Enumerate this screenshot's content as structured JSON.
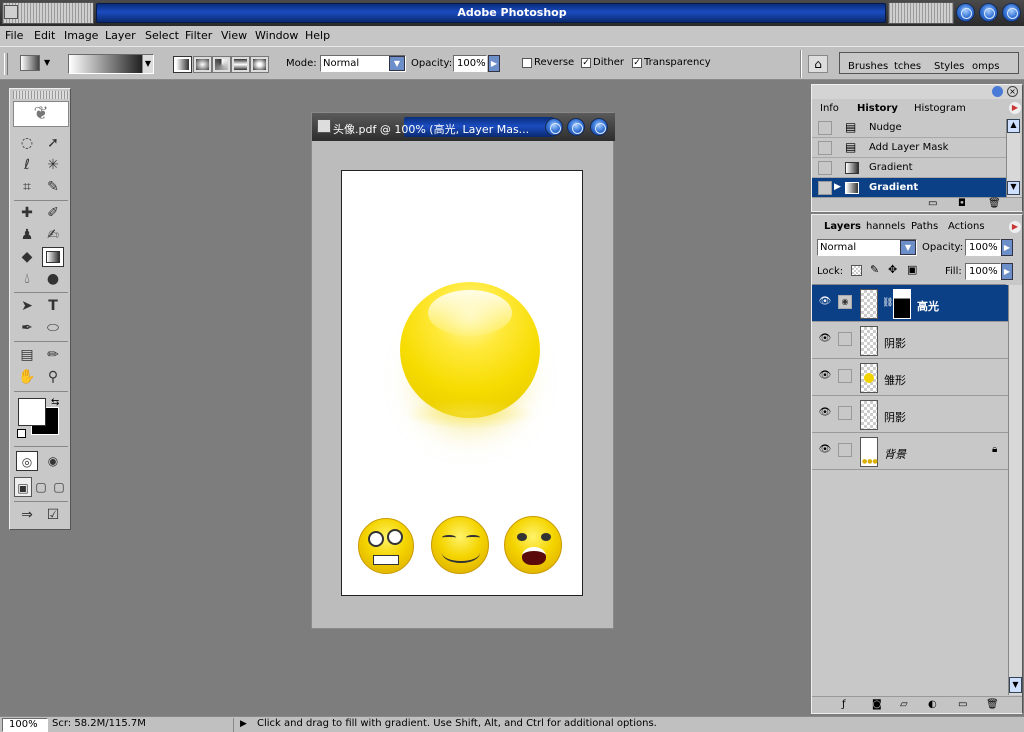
{
  "app": {
    "title": "Adobe Photoshop"
  },
  "menu": [
    "File",
    "Edit",
    "Image",
    "Layer",
    "Select",
    "Filter",
    "View",
    "Window",
    "Help"
  ],
  "options": {
    "mode_label": "Mode:",
    "mode_value": "Normal",
    "opacity_label": "Opacity:",
    "opacity_value": "100%",
    "reverse": "Reverse",
    "dither": "Dither",
    "transparency": "Transparency",
    "tabs": [
      "Brushes",
      "tches",
      "Styles",
      "omps"
    ]
  },
  "document": {
    "title": "头像.pdf @ 100% (高光, Layer Mas..."
  },
  "history": {
    "tabs": [
      "Info",
      "History",
      "Histogram"
    ],
    "items": [
      "Nudge",
      "Add Layer Mask",
      "Gradient",
      "Gradient"
    ]
  },
  "layers": {
    "tabs": [
      "Layers",
      "hannels",
      "Paths",
      "Actions"
    ],
    "blend_mode": "Normal",
    "opacity_label": "Opacity:",
    "opacity_value": "100%",
    "lock_label": "Lock:",
    "fill_label": "Fill:",
    "fill_value": "100%",
    "items": [
      "高光",
      "阴影",
      "雏形",
      "阴影",
      "背景"
    ]
  },
  "status": {
    "zoom": "100%",
    "scratch": "Scr: 58.2M/115.7M",
    "hint": "Click and drag to fill with gradient.  Use Shift, Alt, and Ctrl for additional options."
  },
  "colors": {
    "accent": "#0a3a8c",
    "selection": "#0b3f86",
    "chrome": "#c6c6c6"
  }
}
